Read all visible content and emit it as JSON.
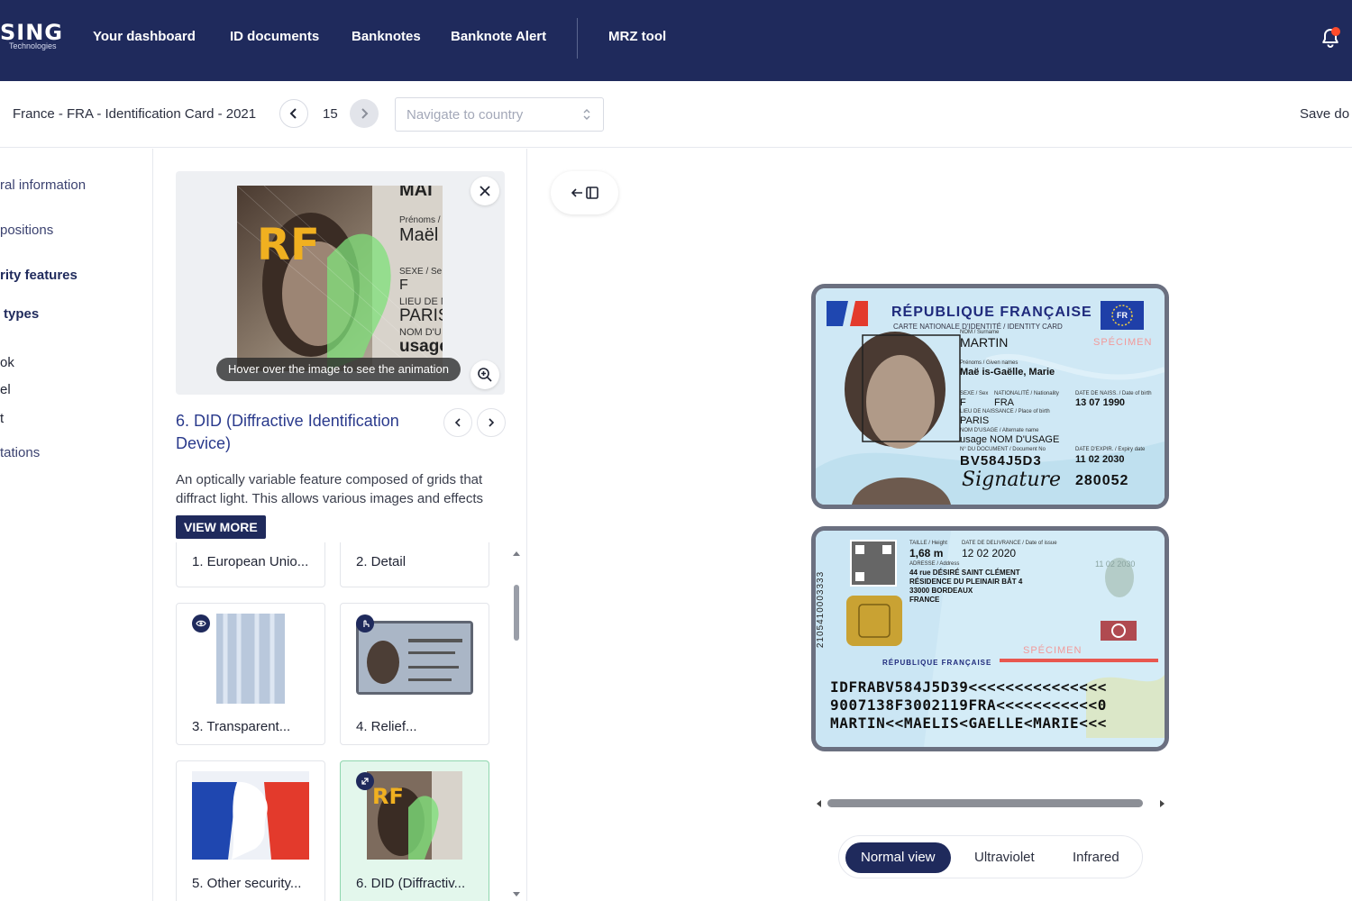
{
  "nav": {
    "logo": "SING",
    "logo_sub": "Technologies",
    "items": [
      "Your dashboard",
      "ID documents",
      "Banknotes",
      "Banknote Alert",
      "MRZ tool"
    ]
  },
  "toolbar": {
    "document_title": "France - FRA - Identification Card - 2021",
    "page": "15",
    "country_placeholder": "Navigate to country",
    "save_label": "Save do"
  },
  "sidebar": {
    "items": [
      "ral information",
      "positions",
      "rity features",
      "types",
      "ok",
      "el",
      "t",
      "tations"
    ]
  },
  "feature": {
    "hover_hint": "Hover over the image to see the animation",
    "title": "6. DID (Diffractive Identification Device)",
    "description": "An optically variable feature composed of grids that diffract light. This allows various images and effects",
    "view_more": "VIEW MORE",
    "cards": [
      "1. European Unio...",
      "2. Detail",
      "3. Transparent...",
      "4. Relief...",
      "5. Other security...",
      "6. DID (Diffractiv..."
    ]
  },
  "preview_text": {
    "rf": "RF",
    "prenoms": "Prénoms / G",
    "name": "Maël",
    "sexe": "SEXE / Se",
    "sex_value": "F",
    "lieu": "LIEU DE N",
    "city": "PARIS",
    "nom": "NOM D'U",
    "usage": "usage",
    "top": "MAI"
  },
  "id_front": {
    "republic": "RÉPUBLIQUE FRANÇAISE",
    "card_type": "CARTE NATIONALE D'IDENTITÉ / IDENTITY CARD",
    "eu": "FR",
    "specimen": "SPÉCIMEN",
    "surname_label": "NOM / Surname",
    "surname": "MARTIN",
    "given_label": "Prénoms / Given names",
    "given": "Maë is-Gaëlle, Marie",
    "sex_label": "SEXE / Sex",
    "sex": "F",
    "nat_label": "NATIONALITÉ / Nationality",
    "nat": "FRA",
    "dob_label": "DATE DE NAISS. / Date of birth",
    "dob": "13 07 1990",
    "pob_label": "LIEU DE NAISSANCE / Place of birth",
    "pob": "PARIS",
    "usage_label": "NOM D'USAGE / Alternate name",
    "usage": "usage NOM D'USAGE",
    "docno_label": "N° DU DOCUMENT / Document No",
    "docno": "BV584J5D3",
    "exp_label": "DATE D'EXPIR. / Expiry date",
    "exp": "11 02 2030",
    "signature": "Signature",
    "can": "280052"
  },
  "id_back": {
    "height_label": "TAILLE / Height",
    "height": "1,68 m",
    "issue_label": "DATE DE DELIVRANCE / Date of issue",
    "issue": "12 02 2020",
    "addr_label": "ADRESSE / Address",
    "addr1": "44 rue DÉSIRÉ SAINT CLÉMENT",
    "addr2": "RÉSIDENCE DU PLEINAIR BÂT 4",
    "addr3": "33000 BORDEAUX",
    "addr4": "FRANCE",
    "vertical": "2105410003333",
    "ghost_date": "11 02 2030",
    "specimen": "SPÉCIMEN",
    "republic": "RÉPUBLIQUE FRANÇAISE",
    "mrz": [
      "IDFRABV584J5D39<<<<<<<<<<<<<<<",
      "9007138F3002119FRA<<<<<<<<<<<0",
      "MARTIN<<MAELIS<GAELLE<MARIE<<<"
    ]
  },
  "viewer": {
    "modes": [
      "Normal view",
      "Ultraviolet",
      "Infrared"
    ]
  },
  "colors": {
    "nav_bg": "#1f2a5c",
    "accent": "#1f2a5c",
    "title_blue": "#2a3a8c",
    "selected_card": "#e3f7ec",
    "notification": "#ff4b2b"
  },
  "icons": [
    "bell-icon",
    "chevron-left-icon",
    "chevron-right-icon",
    "updown-icon",
    "close-icon",
    "zoom-in-icon",
    "eye-icon",
    "touch-icon",
    "rotate-icon",
    "collapse-panel-icon"
  ]
}
